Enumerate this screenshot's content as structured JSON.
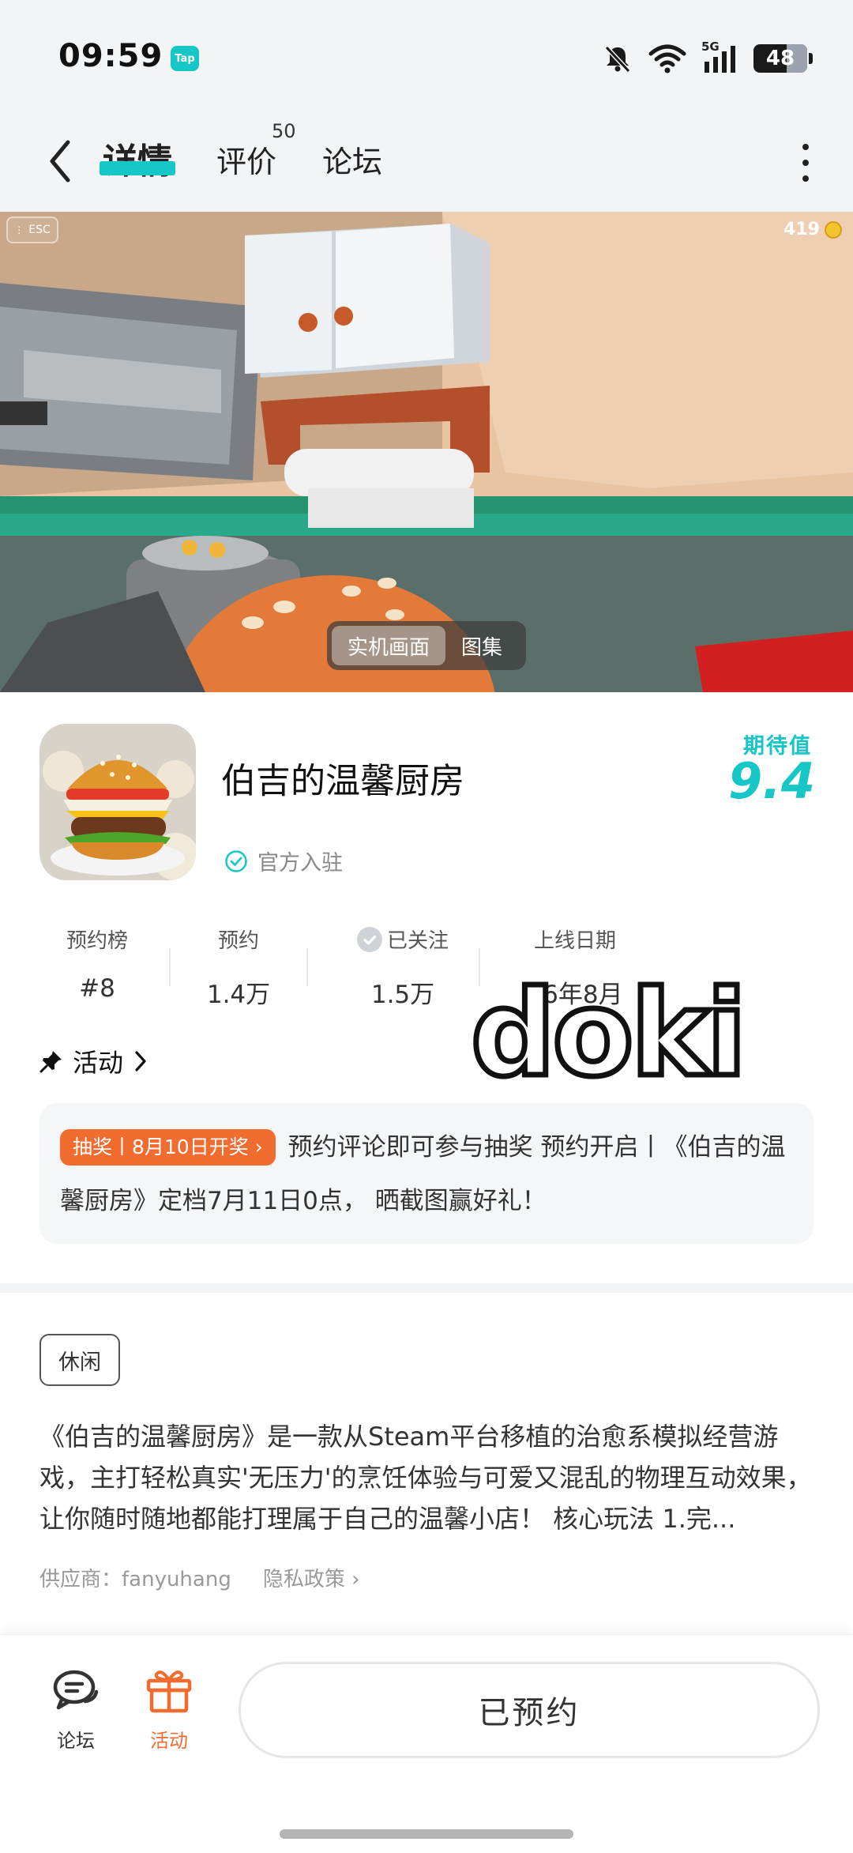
{
  "status_bar": {
    "time": "09:59",
    "app_badge": "Tap",
    "network": "5G",
    "battery": "48"
  },
  "nav": {
    "tabs": [
      {
        "label": "详情",
        "active": true
      },
      {
        "label": "评价",
        "count": "50"
      },
      {
        "label": "论坛"
      }
    ]
  },
  "media": {
    "esc_label": "ESC",
    "coins": "419",
    "toggle": [
      "实机画面",
      "图集"
    ]
  },
  "game": {
    "title": "伯吉的温馨厨房",
    "official_label": "官方入驻",
    "expect_label": "期待值",
    "expect_score": "9.4"
  },
  "stats": [
    {
      "label": "预约榜",
      "value": "#8"
    },
    {
      "label": "预约",
      "value": "1.4万"
    },
    {
      "label": "已关注",
      "value": "1.5万"
    },
    {
      "label": "上线日期",
      "value": "26年8月"
    }
  ],
  "watermark": "doki",
  "activity": {
    "heading": "活动",
    "tag": "抽奖丨8月10日开奖",
    "text": "预约评论即可参与抽奖 预约开启丨《伯吉的温馨厨房》定档7月11日0点， 晒截图赢好礼！"
  },
  "detail": {
    "genre": "休闲",
    "description": "《伯吉的温馨厨房》是一款从Steam平台移植的治愈系模拟经营游戏，主打轻松真实'无压力'的烹饪体验与可爱又混乱的物理互动效果，让你随时随地都能打理属于自己的温馨小店！ 核心玩法 1.完...",
    "supplier": "供应商：fanyuhang",
    "privacy": "隐私政策"
  },
  "bottom_bar": {
    "forum": "论坛",
    "activity": "活动",
    "reserve_button": "已预约"
  },
  "colors": {
    "accent": "#17c6c6",
    "orange": "#f26b2f"
  }
}
